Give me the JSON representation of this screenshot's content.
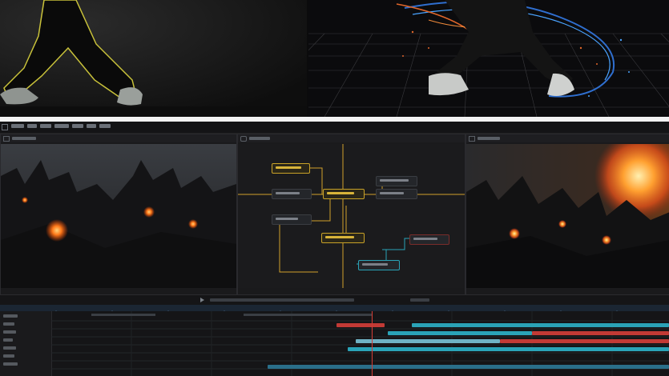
{
  "app": {
    "accent": "#c9a227",
    "node_link_color": "#d2a02a",
    "timeline_clip_colors": [
      "#2aa3b7",
      "#c23a35",
      "#6fb2c4"
    ]
  },
  "hero": {
    "left_image_desc_icon": "dancer-silhouette-image",
    "right_image_desc_icon": "dancer-particles-image"
  },
  "menubar": {
    "icon": "menu-icon"
  },
  "panels": {
    "left_viewer": {
      "icon": "viewer-icon"
    },
    "node_graph": {
      "icon": "node-graph-icon"
    },
    "right_viewer": {
      "icon": "viewer-icon"
    }
  },
  "timeline": {
    "playhead_icon": "playhead-icon"
  }
}
